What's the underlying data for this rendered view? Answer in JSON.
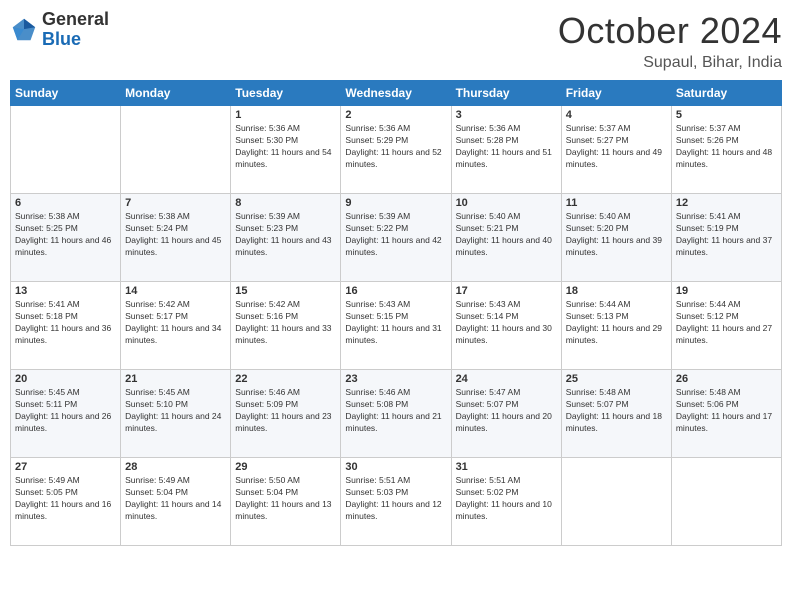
{
  "header": {
    "logo_general": "General",
    "logo_blue": "Blue",
    "month": "October 2024",
    "location": "Supaul, Bihar, India"
  },
  "days_of_week": [
    "Sunday",
    "Monday",
    "Tuesday",
    "Wednesday",
    "Thursday",
    "Friday",
    "Saturday"
  ],
  "weeks": [
    [
      {
        "day": "",
        "sunrise": "",
        "sunset": "",
        "daylight": ""
      },
      {
        "day": "",
        "sunrise": "",
        "sunset": "",
        "daylight": ""
      },
      {
        "day": "1",
        "sunrise": "Sunrise: 5:36 AM",
        "sunset": "Sunset: 5:30 PM",
        "daylight": "Daylight: 11 hours and 54 minutes."
      },
      {
        "day": "2",
        "sunrise": "Sunrise: 5:36 AM",
        "sunset": "Sunset: 5:29 PM",
        "daylight": "Daylight: 11 hours and 52 minutes."
      },
      {
        "day": "3",
        "sunrise": "Sunrise: 5:36 AM",
        "sunset": "Sunset: 5:28 PM",
        "daylight": "Daylight: 11 hours and 51 minutes."
      },
      {
        "day": "4",
        "sunrise": "Sunrise: 5:37 AM",
        "sunset": "Sunset: 5:27 PM",
        "daylight": "Daylight: 11 hours and 49 minutes."
      },
      {
        "day": "5",
        "sunrise": "Sunrise: 5:37 AM",
        "sunset": "Sunset: 5:26 PM",
        "daylight": "Daylight: 11 hours and 48 minutes."
      }
    ],
    [
      {
        "day": "6",
        "sunrise": "Sunrise: 5:38 AM",
        "sunset": "Sunset: 5:25 PM",
        "daylight": "Daylight: 11 hours and 46 minutes."
      },
      {
        "day": "7",
        "sunrise": "Sunrise: 5:38 AM",
        "sunset": "Sunset: 5:24 PM",
        "daylight": "Daylight: 11 hours and 45 minutes."
      },
      {
        "day": "8",
        "sunrise": "Sunrise: 5:39 AM",
        "sunset": "Sunset: 5:23 PM",
        "daylight": "Daylight: 11 hours and 43 minutes."
      },
      {
        "day": "9",
        "sunrise": "Sunrise: 5:39 AM",
        "sunset": "Sunset: 5:22 PM",
        "daylight": "Daylight: 11 hours and 42 minutes."
      },
      {
        "day": "10",
        "sunrise": "Sunrise: 5:40 AM",
        "sunset": "Sunset: 5:21 PM",
        "daylight": "Daylight: 11 hours and 40 minutes."
      },
      {
        "day": "11",
        "sunrise": "Sunrise: 5:40 AM",
        "sunset": "Sunset: 5:20 PM",
        "daylight": "Daylight: 11 hours and 39 minutes."
      },
      {
        "day": "12",
        "sunrise": "Sunrise: 5:41 AM",
        "sunset": "Sunset: 5:19 PM",
        "daylight": "Daylight: 11 hours and 37 minutes."
      }
    ],
    [
      {
        "day": "13",
        "sunrise": "Sunrise: 5:41 AM",
        "sunset": "Sunset: 5:18 PM",
        "daylight": "Daylight: 11 hours and 36 minutes."
      },
      {
        "day": "14",
        "sunrise": "Sunrise: 5:42 AM",
        "sunset": "Sunset: 5:17 PM",
        "daylight": "Daylight: 11 hours and 34 minutes."
      },
      {
        "day": "15",
        "sunrise": "Sunrise: 5:42 AM",
        "sunset": "Sunset: 5:16 PM",
        "daylight": "Daylight: 11 hours and 33 minutes."
      },
      {
        "day": "16",
        "sunrise": "Sunrise: 5:43 AM",
        "sunset": "Sunset: 5:15 PM",
        "daylight": "Daylight: 11 hours and 31 minutes."
      },
      {
        "day": "17",
        "sunrise": "Sunrise: 5:43 AM",
        "sunset": "Sunset: 5:14 PM",
        "daylight": "Daylight: 11 hours and 30 minutes."
      },
      {
        "day": "18",
        "sunrise": "Sunrise: 5:44 AM",
        "sunset": "Sunset: 5:13 PM",
        "daylight": "Daylight: 11 hours and 29 minutes."
      },
      {
        "day": "19",
        "sunrise": "Sunrise: 5:44 AM",
        "sunset": "Sunset: 5:12 PM",
        "daylight": "Daylight: 11 hours and 27 minutes."
      }
    ],
    [
      {
        "day": "20",
        "sunrise": "Sunrise: 5:45 AM",
        "sunset": "Sunset: 5:11 PM",
        "daylight": "Daylight: 11 hours and 26 minutes."
      },
      {
        "day": "21",
        "sunrise": "Sunrise: 5:45 AM",
        "sunset": "Sunset: 5:10 PM",
        "daylight": "Daylight: 11 hours and 24 minutes."
      },
      {
        "day": "22",
        "sunrise": "Sunrise: 5:46 AM",
        "sunset": "Sunset: 5:09 PM",
        "daylight": "Daylight: 11 hours and 23 minutes."
      },
      {
        "day": "23",
        "sunrise": "Sunrise: 5:46 AM",
        "sunset": "Sunset: 5:08 PM",
        "daylight": "Daylight: 11 hours and 21 minutes."
      },
      {
        "day": "24",
        "sunrise": "Sunrise: 5:47 AM",
        "sunset": "Sunset: 5:07 PM",
        "daylight": "Daylight: 11 hours and 20 minutes."
      },
      {
        "day": "25",
        "sunrise": "Sunrise: 5:48 AM",
        "sunset": "Sunset: 5:07 PM",
        "daylight": "Daylight: 11 hours and 18 minutes."
      },
      {
        "day": "26",
        "sunrise": "Sunrise: 5:48 AM",
        "sunset": "Sunset: 5:06 PM",
        "daylight": "Daylight: 11 hours and 17 minutes."
      }
    ],
    [
      {
        "day": "27",
        "sunrise": "Sunrise: 5:49 AM",
        "sunset": "Sunset: 5:05 PM",
        "daylight": "Daylight: 11 hours and 16 minutes."
      },
      {
        "day": "28",
        "sunrise": "Sunrise: 5:49 AM",
        "sunset": "Sunset: 5:04 PM",
        "daylight": "Daylight: 11 hours and 14 minutes."
      },
      {
        "day": "29",
        "sunrise": "Sunrise: 5:50 AM",
        "sunset": "Sunset: 5:04 PM",
        "daylight": "Daylight: 11 hours and 13 minutes."
      },
      {
        "day": "30",
        "sunrise": "Sunrise: 5:51 AM",
        "sunset": "Sunset: 5:03 PM",
        "daylight": "Daylight: 11 hours and 12 minutes."
      },
      {
        "day": "31",
        "sunrise": "Sunrise: 5:51 AM",
        "sunset": "Sunset: 5:02 PM",
        "daylight": "Daylight: 11 hours and 10 minutes."
      },
      {
        "day": "",
        "sunrise": "",
        "sunset": "",
        "daylight": ""
      },
      {
        "day": "",
        "sunrise": "",
        "sunset": "",
        "daylight": ""
      }
    ]
  ]
}
